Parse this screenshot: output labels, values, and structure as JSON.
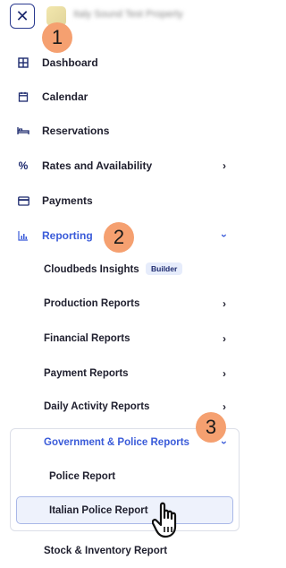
{
  "header": {
    "close_icon": "close-icon",
    "property_name": "Italy Sound Test Property"
  },
  "callouts": [
    "1",
    "2",
    "3"
  ],
  "nav": {
    "dashboard": "Dashboard",
    "calendar": "Calendar",
    "reservations": "Reservations",
    "rates": "Rates and Availability",
    "payments": "Payments",
    "reporting": "Reporting"
  },
  "reporting_sub": {
    "insights": "Cloudbeds Insights",
    "insights_badge": "Builder",
    "production": "Production Reports",
    "financial": "Financial Reports",
    "payment": "Payment Reports",
    "daily": "Daily Activity Reports",
    "government": "Government & Police Reports",
    "police": "Police Report",
    "italian_police": "Italian Police Report",
    "stock": "Stock & Inventory Report"
  },
  "colors": {
    "accent": "#3a5bd9",
    "callout": "#f5a070",
    "navy": "#1d2a6e"
  }
}
